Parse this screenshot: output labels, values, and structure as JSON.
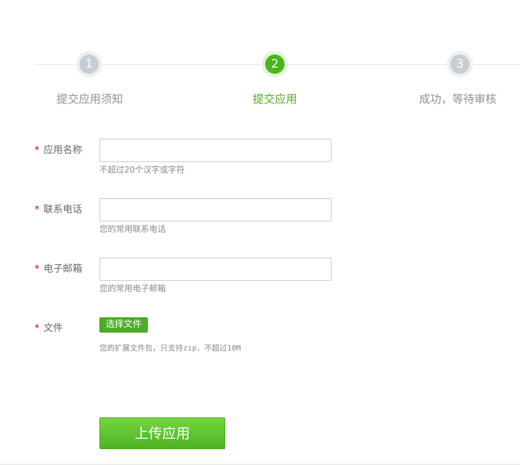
{
  "steps": [
    {
      "number": "1",
      "label": "提交应用须知",
      "state": "done"
    },
    {
      "number": "2",
      "label": "提交应用",
      "state": "active"
    },
    {
      "number": "3",
      "label": "成功，等待审核",
      "state": "pending"
    }
  ],
  "form": {
    "required_mark": "*",
    "app_name": {
      "label": "应用名称",
      "value": "",
      "hint": "不超过20个汉字或字符"
    },
    "phone": {
      "label": "联系电话",
      "value": "",
      "hint": "您的常用联系电话"
    },
    "email": {
      "label": "电子邮箱",
      "value": "",
      "hint": "您的常用电子邮箱"
    },
    "file": {
      "label": "文件",
      "button": "选择文件",
      "hint": "您的扩展文件包，只支持zip，不超过10M"
    },
    "submit": "上传应用"
  },
  "colors": {
    "accent": "#4cae1f",
    "required": "#cc0000"
  }
}
